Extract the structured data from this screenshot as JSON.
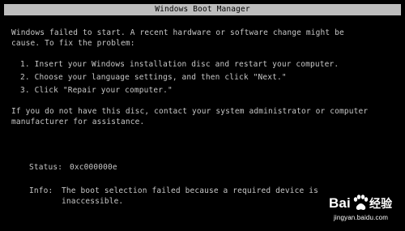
{
  "boot_manager": {
    "title": "Windows Boot Manager",
    "message": {
      "line1": "Windows failed to start. A recent hardware or software change might be",
      "line2": "cause. To fix the problem:"
    },
    "steps": [
      "1. Insert your Windows installation disc and restart your computer.",
      "2. Choose your language settings, and then click \"Next.\"",
      "3. Click \"Repair your computer.\""
    ],
    "contact": {
      "line1": "If you do not have this disc, contact your system administrator or computer",
      "line2": "manufacturer for assistance."
    },
    "status": {
      "label": "Status:",
      "value": "0xc000000e"
    },
    "info": {
      "label": "Info:",
      "line1": "The boot selection failed because a required device is",
      "line2": "inaccessible."
    }
  },
  "watermark": {
    "logo_text": "Bai",
    "logo_text2": "经验",
    "url": "jingyan.baidu.com",
    "icon": "baidu-paw-icon"
  }
}
